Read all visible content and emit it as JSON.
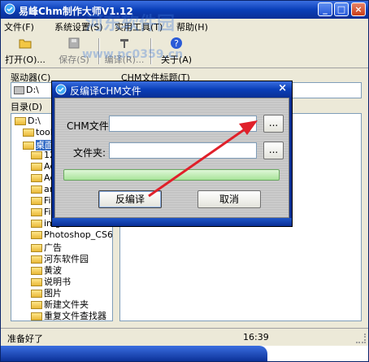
{
  "window": {
    "title": "易峰Chm制作大师V1.12"
  },
  "menu": [
    "文件(F)",
    "系统设置(S)",
    "实用工具(T)",
    "帮助(H)"
  ],
  "toolbar": {
    "open": "打开(O)...",
    "save": "保存(S)",
    "compile": "编译(R)...",
    "about": "关于(A)"
  },
  "left": {
    "drive_label": "驱动器(C)",
    "drive_value": "D:\\",
    "dir_label": "目录(D)",
    "tree": [
      {
        "label": "D:\\",
        "indent": 0
      },
      {
        "label": "tool",
        "indent": 1
      },
      {
        "label": "桌面",
        "indent": 1,
        "selected": true
      },
      {
        "label": "12",
        "indent": 2
      },
      {
        "label": "Ac",
        "indent": 2
      },
      {
        "label": "Ac",
        "indent": 2
      },
      {
        "label": "ar",
        "indent": 2
      },
      {
        "label": "Fi",
        "indent": 2
      },
      {
        "label": "Fi",
        "indent": 2
      },
      {
        "label": "img",
        "indent": 2
      },
      {
        "label": "Photoshop_CS6_",
        "indent": 2
      },
      {
        "label": "广告",
        "indent": 2
      },
      {
        "label": "河东软件园",
        "indent": 2
      },
      {
        "label": "黄波",
        "indent": 2
      },
      {
        "label": "说明书",
        "indent": 2
      },
      {
        "label": "图片",
        "indent": 2
      },
      {
        "label": "新建文件夹",
        "indent": 2
      },
      {
        "label": "重复文件查找器",
        "indent": 2
      }
    ]
  },
  "right": {
    "title_label": "CHM文件标题(T)"
  },
  "status": {
    "text": "准备好了",
    "time": "16:39"
  },
  "watermark": {
    "line1": "河东软件园",
    "line2": "www.pc0359.cn"
  },
  "dialog": {
    "title": "反编译CHM文件",
    "close": "×",
    "chm_label": "CHM文件:",
    "chm_value": "",
    "folder_label": "文件夹:",
    "folder_value": "",
    "browse": "...",
    "progress": 0,
    "ok": "反编译",
    "cancel": "取消"
  },
  "colors": {
    "titlebar": "#0a3fb8",
    "arrow": "#e0202a",
    "progress": "#a9e49a"
  }
}
